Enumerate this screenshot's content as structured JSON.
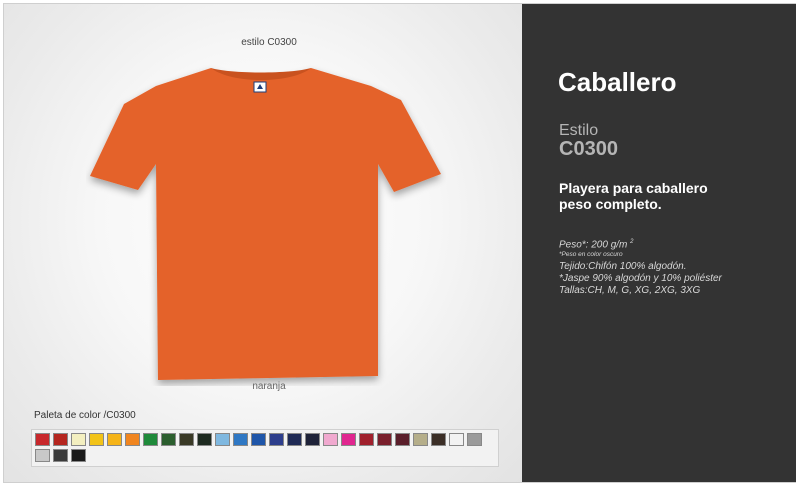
{
  "product": {
    "style_label": "estilo C0300",
    "color_name": "naranja",
    "shirt_color": "#e4622a",
    "shirt_shade": "#c9521f"
  },
  "palette": {
    "label": "Paleta de color /C0300",
    "swatches": [
      "#c8282c",
      "#b5261f",
      "#f3efc0",
      "#f2c318",
      "#f5b418",
      "#f0851f",
      "#1f8a3a",
      "#2b5e2e",
      "#3a3a26",
      "#1d2a20",
      "#7fb8e0",
      "#2f78c4",
      "#1e55a8",
      "#2d3e8c",
      "#1f2a55",
      "#1e2238",
      "#f0a9cf",
      "#e0268f",
      "#a0202c",
      "#7a1f2c",
      "#5a1e2a",
      "#b5ae8a",
      "#3b2e26",
      "#f2f2f2",
      "#9a9a9a",
      "#c8c8c8",
      "#3a3a3a",
      "#1a1a1a"
    ]
  },
  "info": {
    "title": "Caballero",
    "estilo_word": "Estilo",
    "estilo_code": "C0300",
    "desc_line1": "Playera para caballero",
    "desc_line2": "peso completo.",
    "weight_label": "Peso*: 200 g/m",
    "weight_sup": "2",
    "weight_note": "*Peso en color oscuro",
    "fabric": "Tejido:Chifón 100% algodón.",
    "jaspe": "*Jaspe 90% algodón y 10% poliéster",
    "sizes": "Tallas:CH, M, G, XG, 2XG, 3XG"
  }
}
